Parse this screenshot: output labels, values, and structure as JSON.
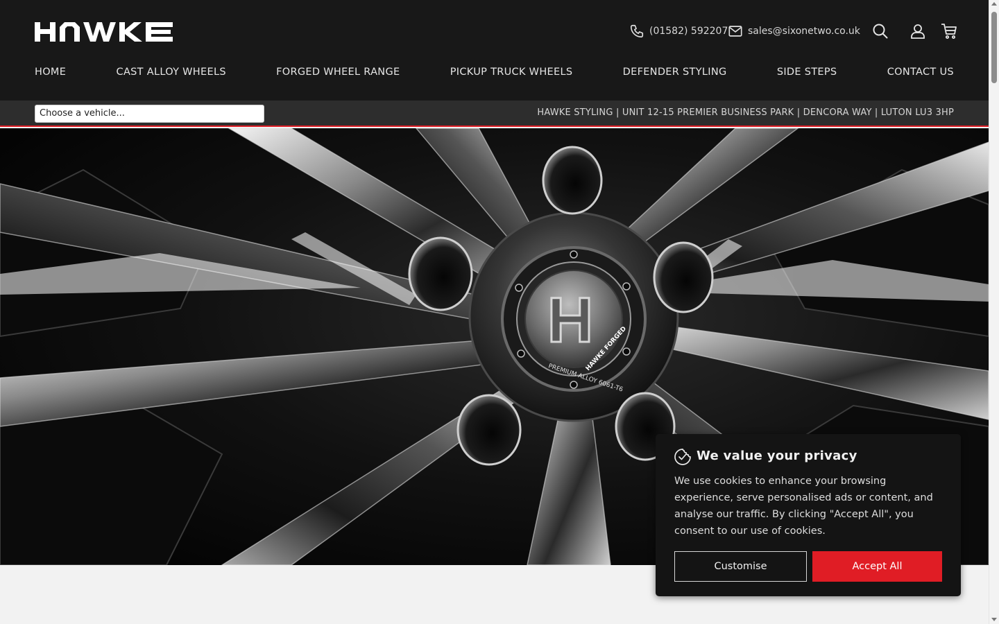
{
  "brand": {
    "logo_text": "HAWKE"
  },
  "header": {
    "phone": "(01582) 592207",
    "email": "sales@sixonetwo.co.uk",
    "icons": [
      "phone-icon",
      "mail-icon",
      "search-icon",
      "account-icon",
      "cart-icon"
    ]
  },
  "nav": {
    "items": [
      {
        "label": "HOME"
      },
      {
        "label": "CAST ALLOY WHEELS"
      },
      {
        "label": "FORGED WHEEL RANGE"
      },
      {
        "label": "PICKUP TRUCK WHEELS"
      },
      {
        "label": "DEFENDER STYLING"
      },
      {
        "label": "SIDE STEPS"
      },
      {
        "label": "CONTACT US"
      }
    ]
  },
  "subbar": {
    "vehicle_placeholder": "Choose a vehicle...",
    "address": "HAWKE STYLING | UNIT 12-15 PREMIER BUSINESS PARK | DENCORA WAY | LUTON LU3 3HP"
  },
  "hero": {
    "centre_cap_letter": "H",
    "cap_text_top": "PREMIUM ALLOY 6061-T6",
    "cap_text_bottom": "HAWKE FORGED"
  },
  "cookie": {
    "title": "We value your privacy",
    "text": "We use cookies to enhance your browsing experience, serve personalised ads or content, and analyse our traffic. By clicking \"Accept All\", you consent to our use of cookies.",
    "customise_label": "Customise",
    "accept_label": "Accept All"
  },
  "colors": {
    "header_bg": "#181818",
    "subbar_bg": "#2d2d2d",
    "accent_red": "#e01d25",
    "cookie_bg": "#141414"
  }
}
